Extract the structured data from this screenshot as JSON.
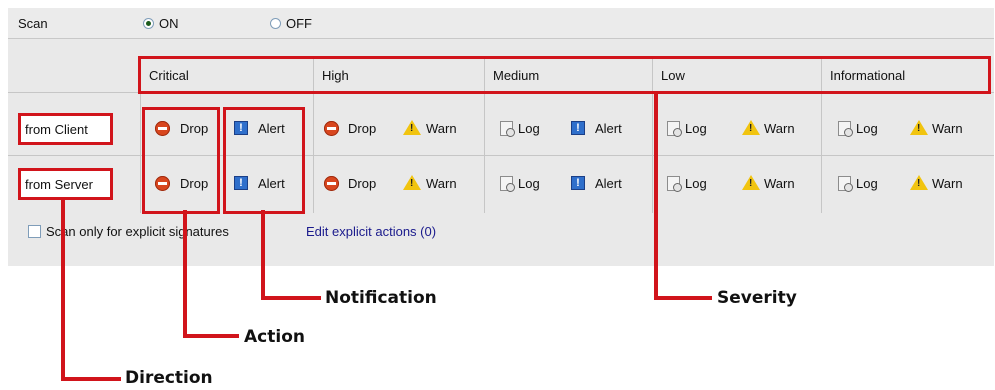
{
  "scan": {
    "label": "Scan",
    "on_label": "ON",
    "off_label": "OFF",
    "selected": "ON"
  },
  "severity_headers": [
    "Critical",
    "High",
    "Medium",
    "Low",
    "Informational"
  ],
  "rows": [
    {
      "direction": "from Client",
      "actions": [
        "Drop",
        "Alert",
        "Drop",
        "Warn",
        "Log",
        "Alert",
        "Log",
        "Warn",
        "Log",
        "Warn"
      ]
    },
    {
      "direction": "from Server",
      "actions": [
        "Drop",
        "Alert",
        "Drop",
        "Warn",
        "Log",
        "Alert",
        "Log",
        "Warn",
        "Log",
        "Warn"
      ]
    }
  ],
  "footer": {
    "explicit_checkbox_label": "Scan only for explicit signatures",
    "explicit_checked": false,
    "edit_link": "Edit explicit actions (0)"
  },
  "callouts": {
    "notification": "Notification",
    "severity": "Severity",
    "action": "Action",
    "direction": "Direction"
  },
  "colors": {
    "highlight": "#d1141b",
    "panel": "#e9e9e9",
    "link": "#1a1a8c"
  }
}
